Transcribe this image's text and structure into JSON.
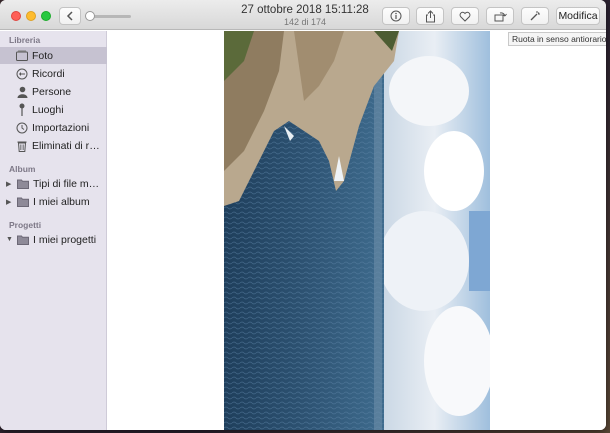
{
  "toolbar": {
    "date": "27 ottobre 2018 15:11:28",
    "count": "142 di 174",
    "edit_label": "Modifica",
    "tooltip": "Ruota in senso antiorario"
  },
  "sidebar": {
    "sections": [
      {
        "title": "Libreria"
      },
      {
        "title": "Album"
      },
      {
        "title": "Progetti"
      }
    ],
    "library_items": [
      {
        "label": "Foto",
        "icon": "photos-icon",
        "selected": true
      },
      {
        "label": "Ricordi",
        "icon": "memories-icon"
      },
      {
        "label": "Persone",
        "icon": "person-icon"
      },
      {
        "label": "Luoghi",
        "icon": "pin-icon"
      },
      {
        "label": "Importazioni",
        "icon": "clock-icon"
      },
      {
        "label": "Eliminati di re...",
        "icon": "trash-icon"
      }
    ],
    "album_items": [
      {
        "label": "Tipi di file mu...",
        "icon": "folder-icon"
      },
      {
        "label": "I miei album",
        "icon": "folder-icon"
      }
    ],
    "project_items": [
      {
        "label": "I miei progetti",
        "icon": "folder-icon"
      }
    ]
  },
  "colors": {
    "sidebar_bg": "#e6e3ed",
    "selected_bg": "#c6c2d1",
    "sea": "#2d5272",
    "sky": "#8fb4d9"
  }
}
